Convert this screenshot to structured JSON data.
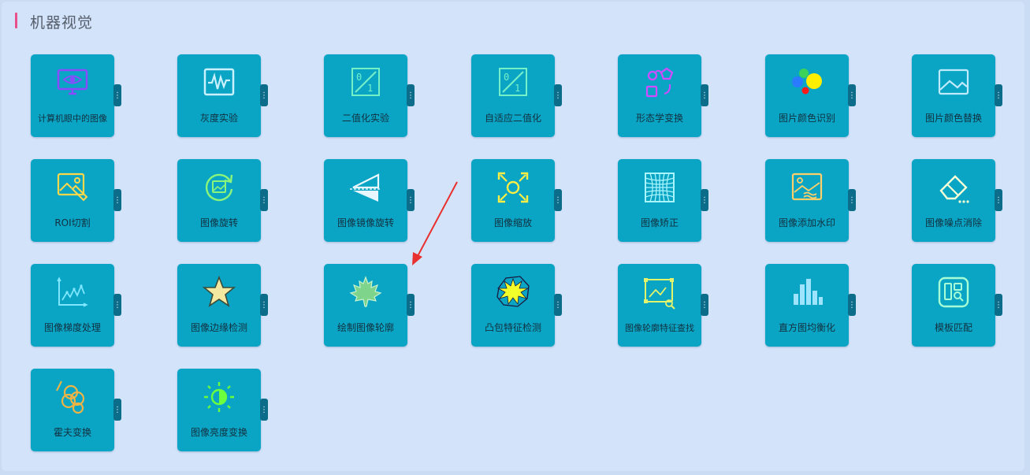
{
  "section": {
    "title": "机器视觉",
    "accent_color": "#e94f8a"
  },
  "tiles": [
    {
      "label": "计算机眼中的图像",
      "icon": "monitor-eye-icon"
    },
    {
      "label": "灰度实验",
      "icon": "waveform-icon"
    },
    {
      "label": "二值化实验",
      "icon": "binary-0-1-icon"
    },
    {
      "label": "自适应二值化",
      "icon": "binary-0-1-icon"
    },
    {
      "label": "形态学变换",
      "icon": "shape-transform-icon"
    },
    {
      "label": "图片颜色识别",
      "icon": "color-dots-icon"
    },
    {
      "label": "图片颜色替换",
      "icon": "image-landscape-icon"
    },
    {
      "label": "ROI切割",
      "icon": "image-cut-icon"
    },
    {
      "label": "图像旋转",
      "icon": "rotate-image-icon"
    },
    {
      "label": "图像镜像旋转",
      "icon": "mirror-triangle-icon"
    },
    {
      "label": "图像缩放",
      "icon": "zoom-frame-icon"
    },
    {
      "label": "图像矫正",
      "icon": "grid-warp-icon"
    },
    {
      "label": "图像添加水印",
      "icon": "image-watermark-icon"
    },
    {
      "label": "图像噪点消除",
      "icon": "eraser-icon"
    },
    {
      "label": "图像梯度处理",
      "icon": "line-graph-icon"
    },
    {
      "label": "图像边缘检测",
      "icon": "star-icon"
    },
    {
      "label": "绘制图像轮廓",
      "icon": "maple-leaf-icon"
    },
    {
      "label": "凸包特征检测",
      "icon": "starburst-icon"
    },
    {
      "label": "图像轮廓特征查找",
      "icon": "image-search-icon"
    },
    {
      "label": "直方图均衡化",
      "icon": "histogram-icon"
    },
    {
      "label": "模板匹配",
      "icon": "template-match-icon"
    },
    {
      "label": "霍夫变换",
      "icon": "hough-circles-icon"
    },
    {
      "label": "图像亮度变换",
      "icon": "brightness-icon"
    }
  ],
  "tile_color": "#0aa5c4",
  "handle_color": "#0c6d8a",
  "annotation_arrow_color": "#e8312f"
}
